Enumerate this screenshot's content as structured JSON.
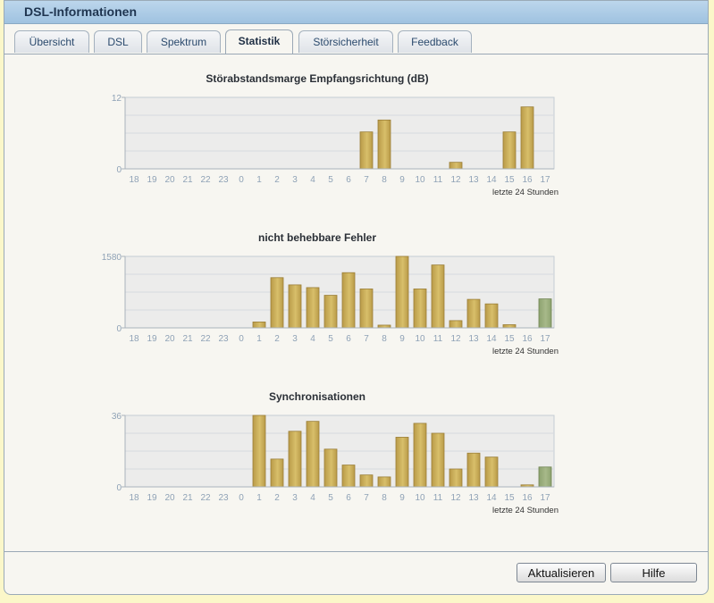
{
  "window": {
    "title": "DSL-Informationen"
  },
  "tabs": [
    {
      "label": "Übersicht",
      "active": false
    },
    {
      "label": "DSL",
      "active": false
    },
    {
      "label": "Spektrum",
      "active": false
    },
    {
      "label": "Statistik",
      "active": true
    },
    {
      "label": "Störsicherheit",
      "active": false
    },
    {
      "label": "Feedback",
      "active": false
    }
  ],
  "colors": {
    "bar_gold": "#d8bf6a",
    "bar_green": "#a7b98a",
    "plot_bg": "#ececeb",
    "tick_text": "#8fa2b6"
  },
  "chart_data": [
    {
      "type": "bar",
      "title": "Störabstandsmarge Empfangsrichtung (dB)",
      "categories": [
        "18",
        "19",
        "20",
        "21",
        "22",
        "23",
        "0",
        "1",
        "2",
        "3",
        "4",
        "5",
        "6",
        "7",
        "8",
        "9",
        "10",
        "11",
        "12",
        "13",
        "14",
        "15",
        "16",
        "17"
      ],
      "values": [
        0,
        0,
        0,
        0,
        0,
        0,
        0,
        0,
        0,
        0,
        0,
        0,
        0,
        6.2,
        8.2,
        0,
        0,
        0,
        1.1,
        0,
        0,
        6.2,
        10.4,
        0
      ],
      "ylim": [
        0,
        12
      ],
      "yticks": [
        "0",
        "12"
      ],
      "xlabel": "letzte 24 Stunden",
      "current_index": 23,
      "grid": true
    },
    {
      "type": "bar",
      "title": "nicht behebbare Fehler",
      "categories": [
        "18",
        "19",
        "20",
        "21",
        "22",
        "23",
        "0",
        "1",
        "2",
        "3",
        "4",
        "5",
        "6",
        "7",
        "8",
        "9",
        "10",
        "11",
        "12",
        "13",
        "14",
        "15",
        "16",
        "17"
      ],
      "values": [
        0,
        0,
        0,
        0,
        0,
        0,
        0,
        130,
        1110,
        950,
        890,
        720,
        1220,
        860,
        60,
        1580,
        860,
        1390,
        160,
        630,
        530,
        70,
        0,
        640
      ],
      "ylim": [
        0,
        1580
      ],
      "yticks": [
        "0",
        "1580"
      ],
      "xlabel": "letzte 24 Stunden",
      "current_index": 23,
      "grid": true
    },
    {
      "type": "bar",
      "title": "Synchronisationen",
      "categories": [
        "18",
        "19",
        "20",
        "21",
        "22",
        "23",
        "0",
        "1",
        "2",
        "3",
        "4",
        "5",
        "6",
        "7",
        "8",
        "9",
        "10",
        "11",
        "12",
        "13",
        "14",
        "15",
        "16",
        "17"
      ],
      "values": [
        0,
        0,
        0,
        0,
        0,
        0,
        0,
        36,
        14,
        28,
        33,
        19,
        11,
        6,
        5,
        25,
        32,
        27,
        9,
        17,
        15,
        0,
        1,
        10
      ],
      "ylim": [
        0,
        36
      ],
      "yticks": [
        "0",
        "36"
      ],
      "xlabel": "letzte 24 Stunden",
      "current_index": 23,
      "grid": true
    }
  ],
  "buttons": {
    "refresh": "Aktualisieren",
    "help": "Hilfe"
  }
}
